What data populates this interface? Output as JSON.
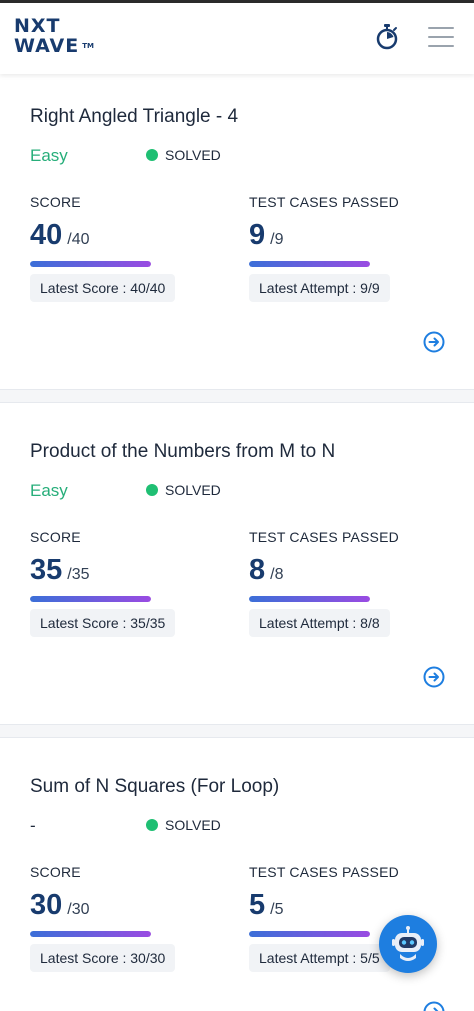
{
  "header": {
    "logo_line1": "NXT",
    "logo_line2": "WAVE",
    "logo_tm": "TM",
    "timer_icon": "stopwatch-icon",
    "menu_icon": "hamburger-menu-icon"
  },
  "colors": {
    "brand_navy": "#183b6e",
    "easy_green": "#27ae7a",
    "solved_dot": "#1fbf73",
    "progress_start": "#3b6fd8",
    "progress_end": "#9a4be2",
    "chatbot_blue": "#1e7ee0"
  },
  "cards": [
    {
      "title": "Right Angled Triangle - 4",
      "difficulty": "Easy",
      "status": "SOLVED",
      "score_label": "SCORE",
      "score": "40",
      "score_max": "/40",
      "score_progress": 1.0,
      "latest_score": "Latest Score : 40/40",
      "tests_label": "TEST CASES PASSED",
      "tests": "9",
      "tests_max": "/9",
      "tests_progress": 1.0,
      "latest_attempt": "Latest Attempt : 9/9"
    },
    {
      "title": "Product of the Numbers from M to N",
      "difficulty": "Easy",
      "status": "SOLVED",
      "score_label": "SCORE",
      "score": "35",
      "score_max": "/35",
      "score_progress": 1.0,
      "latest_score": "Latest Score : 35/35",
      "tests_label": "TEST CASES PASSED",
      "tests": "8",
      "tests_max": "/8",
      "tests_progress": 1.0,
      "latest_attempt": "Latest Attempt : 8/8"
    },
    {
      "title": "Sum of N Squares (For Loop)",
      "difficulty": "-",
      "status": "SOLVED",
      "score_label": "SCORE",
      "score": "30",
      "score_max": "/30",
      "score_progress": 1.0,
      "latest_score": "Latest Score : 30/30",
      "tests_label": "TEST CASES PASSED",
      "tests": "5",
      "tests_max": "/5",
      "tests_progress": 1.0,
      "latest_attempt": "Latest Attempt : 5/5"
    }
  ],
  "chatbot_icon": "robot-icon",
  "card_arrow_icon": "arrow-right-circle-icon"
}
